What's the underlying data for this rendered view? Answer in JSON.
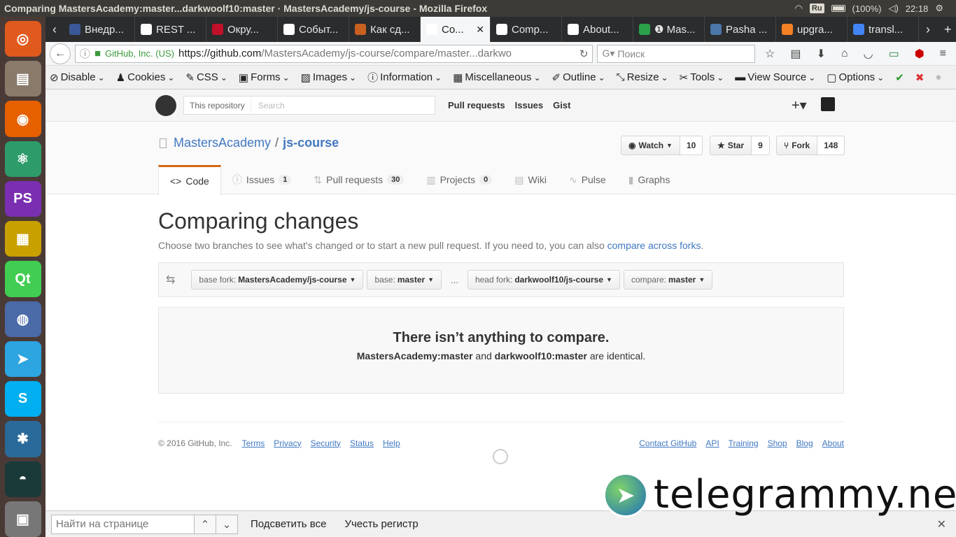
{
  "os": {
    "window_title": "Comparing MastersAcademy:master...darkwoolf10:master · MastersAcademy/js-course - Mozilla Firefox",
    "keyboard_layout": "Ru",
    "battery": "(100%)",
    "clock": "22:18"
  },
  "launcher": {
    "apps": [
      {
        "name": "ubuntu",
        "color": "#e05a1e",
        "glyph": "◎"
      },
      {
        "name": "files",
        "color": "#8a7a6a",
        "glyph": "▤"
      },
      {
        "name": "firefox",
        "color": "#e66000",
        "glyph": "◉"
      },
      {
        "name": "atom",
        "color": "#2d9c6a",
        "glyph": "⚛"
      },
      {
        "name": "phpstorm",
        "color": "#7a2fb0",
        "glyph": "PS"
      },
      {
        "name": "blocks",
        "color": "#c8a000",
        "glyph": "▦"
      },
      {
        "name": "qt",
        "color": "#41cd52",
        "glyph": "Qt"
      },
      {
        "name": "eclipse",
        "color": "#4a6aa8",
        "glyph": "◍"
      },
      {
        "name": "telegram",
        "color": "#2ca5e0",
        "glyph": "➤"
      },
      {
        "name": "skype",
        "color": "#00aff0",
        "glyph": "S"
      },
      {
        "name": "app-blue",
        "color": "#2a6a9a",
        "glyph": "✱"
      },
      {
        "name": "gitkraken",
        "color": "#1a3a3a",
        "glyph": "◓"
      },
      {
        "name": "installer",
        "color": "#777777",
        "glyph": "▣"
      }
    ]
  },
  "browser": {
    "tabs": [
      {
        "label": "Внедр...",
        "color": "#3b5998"
      },
      {
        "label": "REST ...",
        "color": "#ffffff"
      },
      {
        "label": "Окру...",
        "color": "#c0102a"
      },
      {
        "label": "Событ...",
        "color": "#ffffff"
      },
      {
        "label": "Как сд...",
        "color": "#c86020"
      },
      {
        "label": "Co...",
        "color": "#ffffff",
        "active": true
      },
      {
        "label": "Comp...",
        "color": "#ffffff"
      },
      {
        "label": "About...",
        "color": "#ffffff"
      },
      {
        "label": "❶ Mas...",
        "color": "#2aa04a"
      },
      {
        "label": "Pasha ...",
        "color": "#4a76a8"
      },
      {
        "label": "upgra...",
        "color": "#f48024"
      },
      {
        "label": "transl...",
        "color": "#4285f4"
      }
    ],
    "url_org": "GitHub, Inc. (US)",
    "url_prefix": "https://github.com",
    "url_path": "/MastersAcademy/js-course/compare/master...darkwo",
    "search_placeholder": "Поиск",
    "dev_toolbar": [
      "Disable",
      "Cookies",
      "CSS",
      "Forms",
      "Images",
      "Information",
      "Miscellaneous",
      "Outline",
      "Resize",
      "Tools",
      "View Source",
      "Options"
    ]
  },
  "github": {
    "search_scope": "This repository",
    "search_placeholder": "Search",
    "nav": [
      "Pull requests",
      "Issues",
      "Gist"
    ],
    "repo_owner": "MastersAcademy",
    "repo_sep": "/",
    "repo_name": "js-course",
    "watch": {
      "label": "Watch",
      "count": "10"
    },
    "star": {
      "label": "Star",
      "count": "9"
    },
    "fork": {
      "label": "Fork",
      "count": "148"
    },
    "tabs": [
      {
        "label": "Code",
        "icon": "<>",
        "selected": true
      },
      {
        "label": "Issues",
        "icon": "ⓘ",
        "count": "1"
      },
      {
        "label": "Pull requests",
        "icon": "⇅",
        "count": "30"
      },
      {
        "label": "Projects",
        "icon": "▥",
        "count": "0"
      },
      {
        "label": "Wiki",
        "icon": "▤"
      },
      {
        "label": "Pulse",
        "icon": "∿"
      },
      {
        "label": "Graphs",
        "icon": "▮"
      }
    ],
    "heading": "Comparing changes",
    "subtext": "Choose two branches to see what's changed or to start a new pull request. If you need to, you can also",
    "subtext_link": "compare across forks",
    "range": {
      "base_fork_label": "base fork:",
      "base_fork_value": "MastersAcademy/js-course",
      "base_label": "base:",
      "base_value": "master",
      "ellipsis": "...",
      "head_fork_label": "head fork:",
      "head_fork_value": "darkwoolf10/js-course",
      "compare_label": "compare:",
      "compare_value": "master"
    },
    "blank_title": "There isn’t anything to compare.",
    "blank_left": "MastersAcademy:master",
    "blank_and": "and",
    "blank_right": "darkwoolf10:master",
    "blank_tail": "are identical.",
    "footer_copy": "© 2016 GitHub, Inc.",
    "footer_left": [
      "Terms",
      "Privacy",
      "Security",
      "Status",
      "Help"
    ],
    "footer_right": [
      "Contact GitHub",
      "API",
      "Training",
      "Shop",
      "Blog",
      "About"
    ]
  },
  "watermark": "telegrammy.net",
  "findbar": {
    "placeholder": "Найти на странице",
    "highlight_all": "Подсветить все",
    "match_case": "Учесть регистр"
  }
}
